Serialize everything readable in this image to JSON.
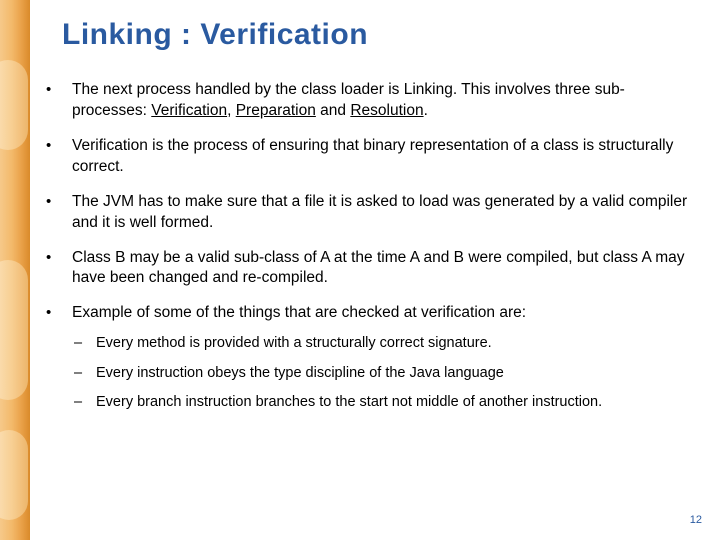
{
  "title": "Linking : Verification",
  "bullets": [
    {
      "pre": "The next process handled by the class loader is Linking.  This involves three sub-processes: ",
      "u1": "Verification",
      "mid1": ", ",
      "u2": "Preparation",
      "mid2": " and ",
      "u3": "Resolution",
      "post": "."
    },
    {
      "text": "Verification is the process of ensuring that binary representation of a class is structurally correct."
    },
    {
      "text": "The JVM has to make sure that a file it is asked to load was generated by a valid compiler and it is well formed."
    },
    {
      "text": "Class B may be a valid sub-class of A at the time A and B were compiled, but class A may have been changed and re-compiled."
    },
    {
      "text": "Example of some of the things that are checked at verification are:",
      "sub": [
        "Every method is provided with a structurally correct signature.",
        "Every instruction obeys the type discipline of the Java language",
        "Every branch instruction branches to the start not middle of another instruction."
      ]
    }
  ],
  "page_number": "12"
}
